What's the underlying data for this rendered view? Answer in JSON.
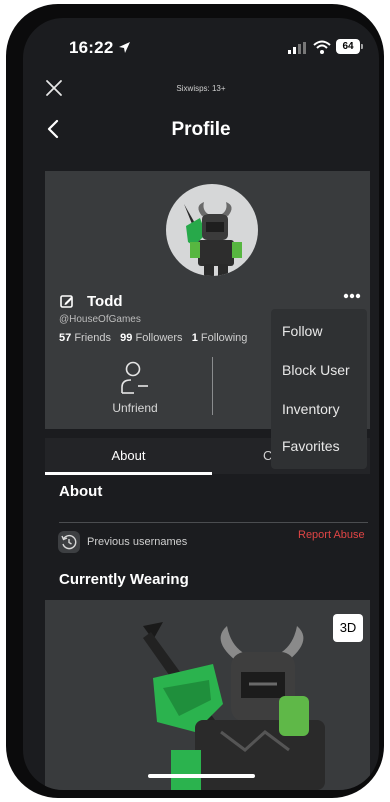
{
  "status_bar": {
    "time": "16:22",
    "battery": "64"
  },
  "top_bar": {
    "game_title": "Sixwisps: 13+",
    "page_title": "Profile"
  },
  "profile": {
    "display_name": "Todd",
    "username": "@HouseOfGames",
    "friends_count": "57",
    "friends_label": "Friends",
    "followers_count": "99",
    "followers_label": "Followers",
    "following_count": "1",
    "following_label": "Following",
    "unfriend_label": "Unfriend"
  },
  "menu": {
    "items": [
      {
        "label": "Follow"
      },
      {
        "label": "Block User"
      },
      {
        "label": "Inventory"
      },
      {
        "label": "Favorites"
      }
    ]
  },
  "tabs": {
    "about": "About",
    "creations": "Cr"
  },
  "about": {
    "heading": "About",
    "previous_usernames": "Previous usernames",
    "report_abuse": "Report Abuse"
  },
  "wearing": {
    "heading": "Currently Wearing",
    "view_3d": "3D"
  },
  "colors": {
    "background": "#1b1c1f",
    "card": "#393b3d",
    "report": "#e04545",
    "accent_green": "#3fbf5f"
  }
}
